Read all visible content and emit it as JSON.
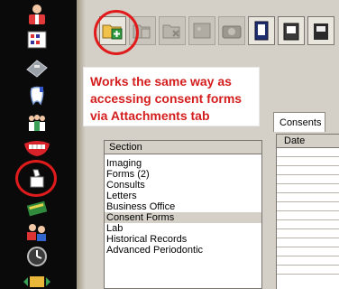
{
  "annotation": {
    "lines": [
      "Works the same way as",
      "accessing consent forms",
      "via Attachments tab"
    ]
  },
  "tab": {
    "label": "Consents"
  },
  "section_panel": {
    "header": "Section",
    "items": [
      "Imaging",
      "Forms (2)",
      "Consults",
      "Letters",
      "Business Office",
      "Consent Forms",
      "Lab",
      "Historical Records",
      "Advanced Periodontic"
    ],
    "selected": "Consent Forms"
  },
  "date_grid": {
    "header": "Date"
  },
  "colors": {
    "annotation_red": "#d41e1e",
    "highlight_circle": "#e01b1b",
    "window_gray": "#d4d0c8",
    "left_bar": "#0a0a0a"
  },
  "icons": {
    "left_toolbar": [
      "doctor-icon",
      "chart-grid-icon",
      "calculator-icon",
      "tooth-icon",
      "people-icon",
      "teeth-smile-icon",
      "document-hand-icon",
      "book-icon",
      "patients-transfer-icon",
      "clock-icon",
      "folder-arrows-icon"
    ],
    "top_toolbar": [
      "folder-add-icon",
      "folder-edit-icon",
      "folder-delete-icon",
      "image-grid-icon",
      "camera-icon",
      "document-open-icon",
      "scanner-icon"
    ]
  }
}
